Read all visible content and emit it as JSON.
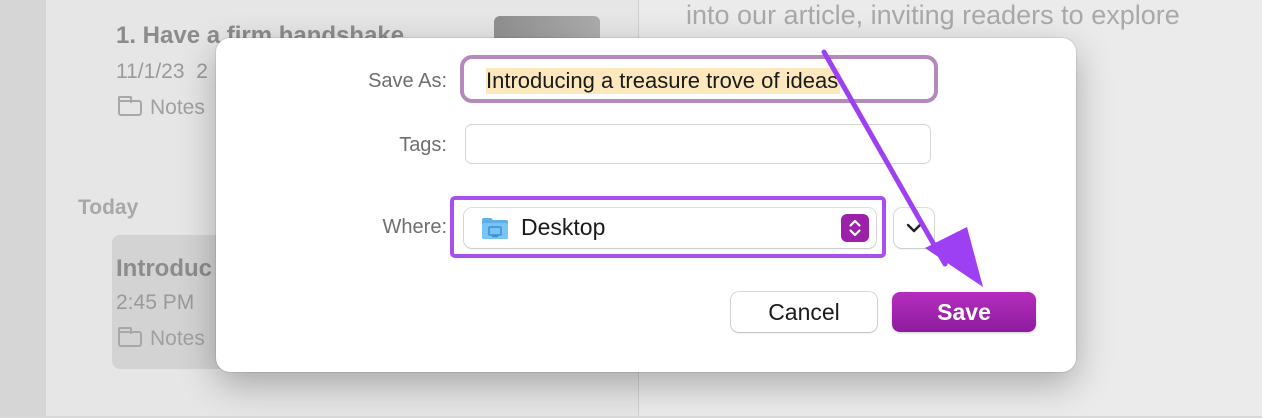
{
  "background": {
    "notes": [
      {
        "title": "1. Have a firm handshake",
        "date": "11/1/23",
        "date_suffix": "2",
        "folder": "Notes"
      },
      {
        "title": "Introduc",
        "date": "2:45 PM",
        "folder": "Notes"
      }
    ],
    "section_label": "Today",
    "editor_text": "into our article, inviting readers to explore"
  },
  "dialog": {
    "save_as_label": "Save As:",
    "save_as_value": "Introducing a treasure trove of ideas",
    "tags_label": "Tags:",
    "tags_value": "",
    "where_label": "Where:",
    "where_value": "Desktop",
    "cancel_label": "Cancel",
    "save_label": "Save"
  },
  "colors": {
    "accent": "#9b21a8",
    "highlight_outline": "#a650f0",
    "annotation_arrow": "#9d3ff2",
    "selection": "#fde8bd"
  },
  "icons": {
    "where_icon": "desktop-folder-icon",
    "stepper_icon": "chevron-up-down-icon",
    "expand_icon": "chevron-down-icon",
    "note_folder_icon": "folder-icon"
  }
}
